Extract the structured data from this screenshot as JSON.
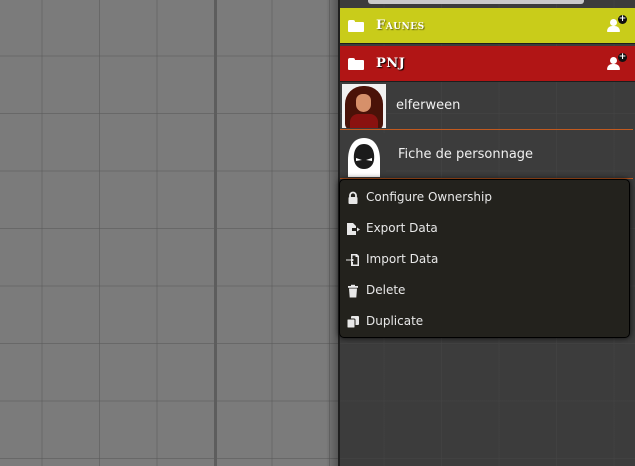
{
  "sidebar": {
    "folders": [
      {
        "label": "Faunes",
        "color": "#c9cc1a",
        "icon": "folder-icon",
        "action_icon": "create-actor-icon"
      },
      {
        "label": "PNJ",
        "color": "#b11515",
        "icon": "folder-icon",
        "action_icon": "create-actor-icon"
      }
    ],
    "actors": [
      {
        "name": "elferween",
        "thumbnail": "elf-portrait"
      },
      {
        "name": "Fiche de personnage",
        "thumbnail": "hooded-figure-icon"
      }
    ]
  },
  "context_menu": {
    "items": [
      {
        "label": "Configure Ownership",
        "icon": "lock-icon"
      },
      {
        "label": "Export Data",
        "icon": "file-export-icon"
      },
      {
        "label": "Import Data",
        "icon": "file-import-icon"
      },
      {
        "label": "Delete",
        "icon": "trash-icon"
      },
      {
        "label": "Duplicate",
        "icon": "copy-icon"
      }
    ]
  },
  "colors": {
    "canvas": "#7b7b7b",
    "sidebar": "#3c3c3c",
    "menu_bg": "#23221d",
    "accent_border": "#c25a1f"
  }
}
